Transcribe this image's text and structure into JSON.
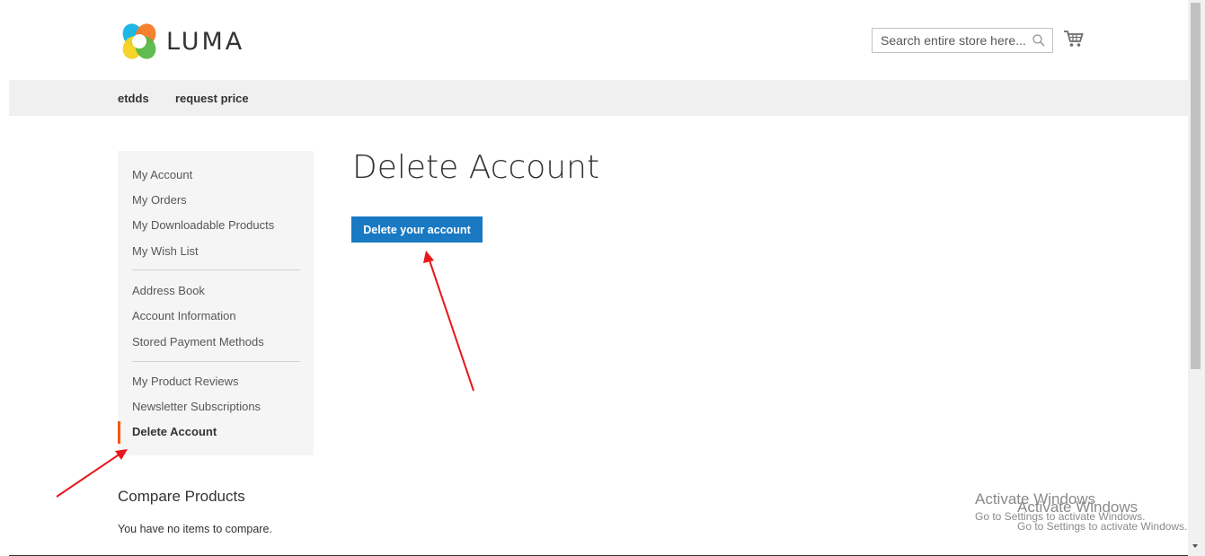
{
  "header": {
    "logo_text": "LUMA",
    "search": {
      "placeholder": "Search entire store here...",
      "value": ""
    },
    "icons": {
      "search": "search-icon",
      "cart": "cart-icon"
    }
  },
  "nav": {
    "items": [
      {
        "label": "etdds"
      },
      {
        "label": "request price"
      }
    ]
  },
  "sidebar": {
    "items": [
      {
        "label": "My Account"
      },
      {
        "label": "My Orders"
      },
      {
        "label": "My Downloadable Products"
      },
      {
        "label": "My Wish List"
      },
      {
        "label": "Address Book"
      },
      {
        "label": "Account Information"
      },
      {
        "label": "Stored Payment Methods"
      },
      {
        "label": "My Product Reviews"
      },
      {
        "label": "Newsletter Subscriptions"
      },
      {
        "label": "Delete Account",
        "current": true
      }
    ]
  },
  "main": {
    "title": "Delete Account",
    "button_label": "Delete your account"
  },
  "compare": {
    "title": "Compare Products",
    "empty_text": "You have no items to compare."
  },
  "windows_watermark": {
    "title": "Activate Windows",
    "subtitle": "Go to Settings to activate Windows."
  },
  "colors": {
    "primary_button": "#1979c3",
    "current_indicator": "#ff5501",
    "nav_background": "#f0f0f0",
    "sidebar_background": "#f5f5f5",
    "annotation_arrow": "#e8161b"
  }
}
